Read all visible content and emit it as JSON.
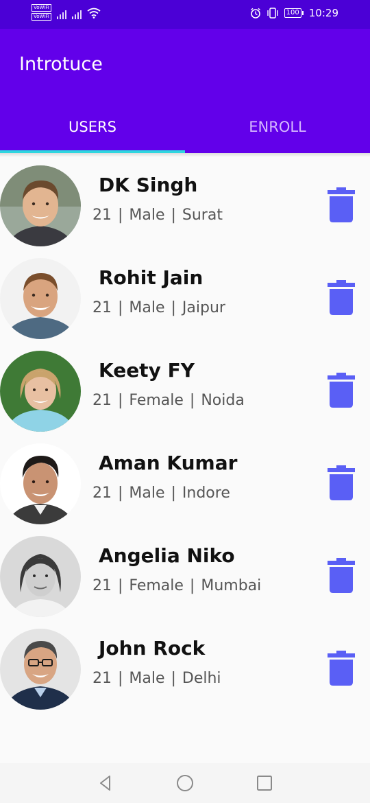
{
  "status_bar": {
    "vowifi_1": "VoWiFi",
    "vowifi_2": "VoWiFi",
    "battery": "100",
    "time": "10:29"
  },
  "app": {
    "title": "Introtuce",
    "primary_color": "#6200ea",
    "accent_color": "#2fd6df",
    "icon_color": "#5a5ff5"
  },
  "tabs": [
    {
      "label": "USERS",
      "active": true
    },
    {
      "label": "ENROLL",
      "active": false
    }
  ],
  "users": [
    {
      "name": "DK Singh",
      "meta": "21 | Male | Surat"
    },
    {
      "name": "Rohit Jain",
      "meta": "21 | Male | Jaipur"
    },
    {
      "name": "Keety FY",
      "meta": "21 | Female | Noida"
    },
    {
      "name": "Aman Kumar",
      "meta": "21 | Male | Indore"
    },
    {
      "name": "Angelia Niko",
      "meta": "21 | Female | Mumbai"
    },
    {
      "name": "John Rock",
      "meta": "21 | Male | Delhi"
    }
  ],
  "icons": {
    "delete": "trash-icon",
    "nav_back": "back-triangle-icon",
    "nav_home": "home-circle-icon",
    "nav_recents": "recents-square-icon"
  }
}
